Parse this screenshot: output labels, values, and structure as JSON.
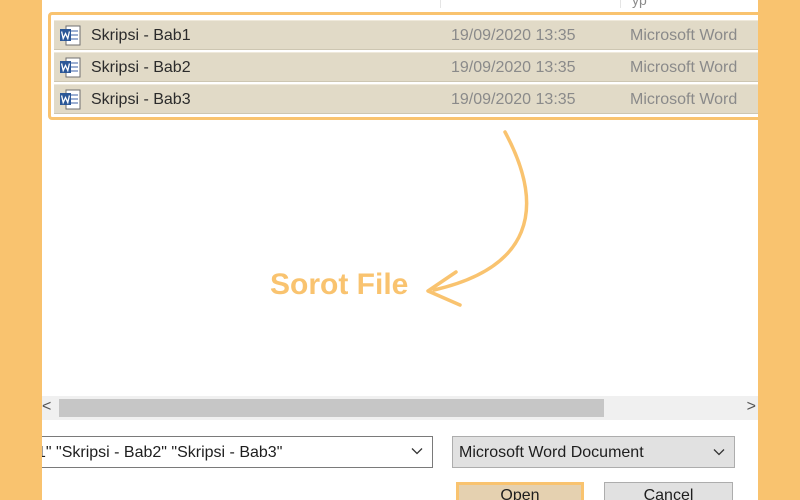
{
  "file_list": {
    "column_peek": "yp",
    "rows": [
      {
        "name": "Skripsi - Bab1",
        "date": "19/09/2020 13:35",
        "type": "Microsoft Word"
      },
      {
        "name": "Skripsi - Bab2",
        "date": "19/09/2020 13:35",
        "type": "Microsoft Word"
      },
      {
        "name": "Skripsi - Bab3",
        "date": "19/09/2020 13:35",
        "type": "Microsoft Word"
      }
    ]
  },
  "annotation": {
    "label": "Sorot File",
    "color": "#f9c36f"
  },
  "scrollbar": {
    "left_arrow": "<",
    "right_arrow": ">"
  },
  "footer": {
    "filename_value": "1\" \"Skripsi - Bab2\" \"Skripsi - Bab3\"",
    "filetype_value": "Microsoft Word Document",
    "open_label": "Open",
    "cancel_label": "Cancel"
  },
  "icons": {
    "file_icon": "word-document-icon",
    "dropdown_icon": "chevron-down-icon"
  }
}
